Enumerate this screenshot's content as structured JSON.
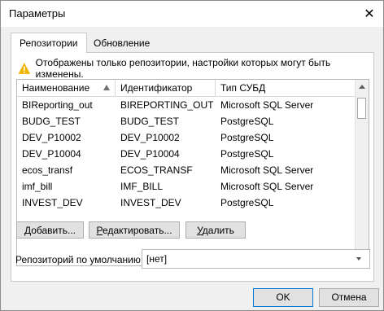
{
  "window": {
    "title": "Параметры"
  },
  "tabs": [
    {
      "label": "Репозитории",
      "active": true
    },
    {
      "label": "Обновление",
      "active": false
    }
  ],
  "warning": {
    "text": "Отображены только репозитории, настройки которых могут быть изменены.",
    "icon": "warning-icon"
  },
  "grid": {
    "columns": [
      "Наименование",
      "Идентификатор",
      "Тип СУБД"
    ],
    "sort_column": "Наименование",
    "rows": [
      [
        "BIReporting_out",
        "BIREPORTING_OUT",
        "Microsoft SQL Server"
      ],
      [
        "BUDG_TEST",
        "BUDG_TEST",
        "PostgreSQL"
      ],
      [
        "DEV_P10002",
        "DEV_P10002",
        "PostgreSQL"
      ],
      [
        "DEV_P10004",
        "DEV_P10004",
        "PostgreSQL"
      ],
      [
        "ecos_transf",
        "ECOS_TRANSF",
        "Microsoft SQL Server"
      ],
      [
        "imf_bill",
        "IMF_BILL",
        "Microsoft SQL Server"
      ],
      [
        "INVEST_DEV",
        "INVEST_DEV",
        "PostgreSQL"
      ]
    ]
  },
  "buttons": {
    "add_prefix": "Д",
    "add_rest": "обавить...",
    "edit_prefix": "Р",
    "edit_rest": "едактировать...",
    "delete_prefix": "У",
    "delete_rest": "далить"
  },
  "default_repo": {
    "label": "Репозиторий по умолчанию:",
    "value": "[нет]"
  },
  "footer": {
    "ok": "OK",
    "cancel": "Отмена"
  },
  "colors": {
    "accent": "#0078d7",
    "warning": "#f0b400"
  }
}
